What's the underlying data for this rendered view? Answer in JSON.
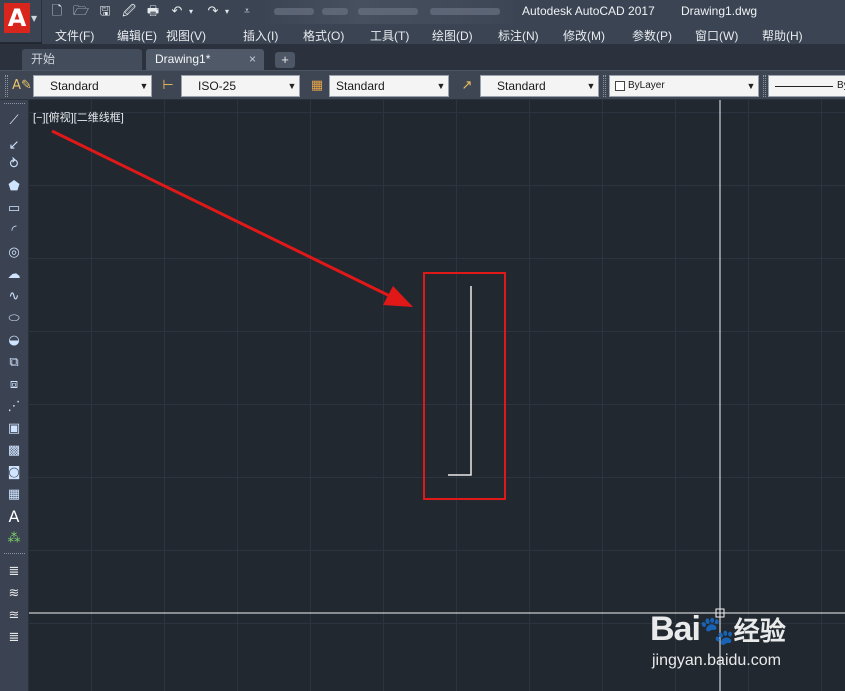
{
  "window": {
    "app_title": "Autodesk AutoCAD 2017",
    "doc_title": "Drawing1.dwg",
    "logo_letter": "A"
  },
  "quick_access": {
    "icons": [
      "new-icon",
      "open-icon",
      "save-icon",
      "save-as-icon",
      "print-icon",
      "undo-icon",
      "redo-icon",
      "customize-icon"
    ]
  },
  "menu": {
    "items": [
      "文件(F)",
      "编辑(E)",
      "视图(V)",
      "插入(I)",
      "格式(O)",
      "工具(T)",
      "绘图(D)",
      "标注(N)",
      "修改(M)",
      "参数(P)",
      "窗口(W)",
      "帮助(H)"
    ]
  },
  "tabs": {
    "start": "开始",
    "drawing": "Drawing1*",
    "close_glyph": "×",
    "new_glyph": "+"
  },
  "styles_toolbar": {
    "text_style": "Standard",
    "dim_style": "ISO-25",
    "table_style": "Standard",
    "multileader_style": "Standard",
    "layer_color": "ByLayer",
    "linetype_partial": "By"
  },
  "viewport": {
    "label": "[−][俯视][二维线框]"
  },
  "draw_toolbar": {
    "tools": [
      "line-icon",
      "construction-line-icon",
      "polyline-icon",
      "polygon-icon",
      "rectangle-icon",
      "arc-icon",
      "circle-icon",
      "revision-cloud-icon",
      "spline-icon",
      "ellipse-icon",
      "ellipse-arc-icon",
      "insert-block-icon",
      "make-block-icon",
      "point-icon",
      "hatch-icon",
      "gradient-icon",
      "region-icon",
      "table-icon",
      "multiline-text-icon",
      "add-selected-icon",
      "layer-tool-1-icon",
      "layer-tool-2-icon",
      "layer-tool-3-icon",
      "layer-tool-4-icon"
    ],
    "text_tool_glyph": "A"
  },
  "colors": {
    "highlight_red": "#e01818",
    "canvas_bg": "#212830",
    "crosshair": "#ffffff"
  },
  "watermark": {
    "brand": "Bai",
    "brand_cn": "经验",
    "url": "jingyan.baidu.com"
  }
}
